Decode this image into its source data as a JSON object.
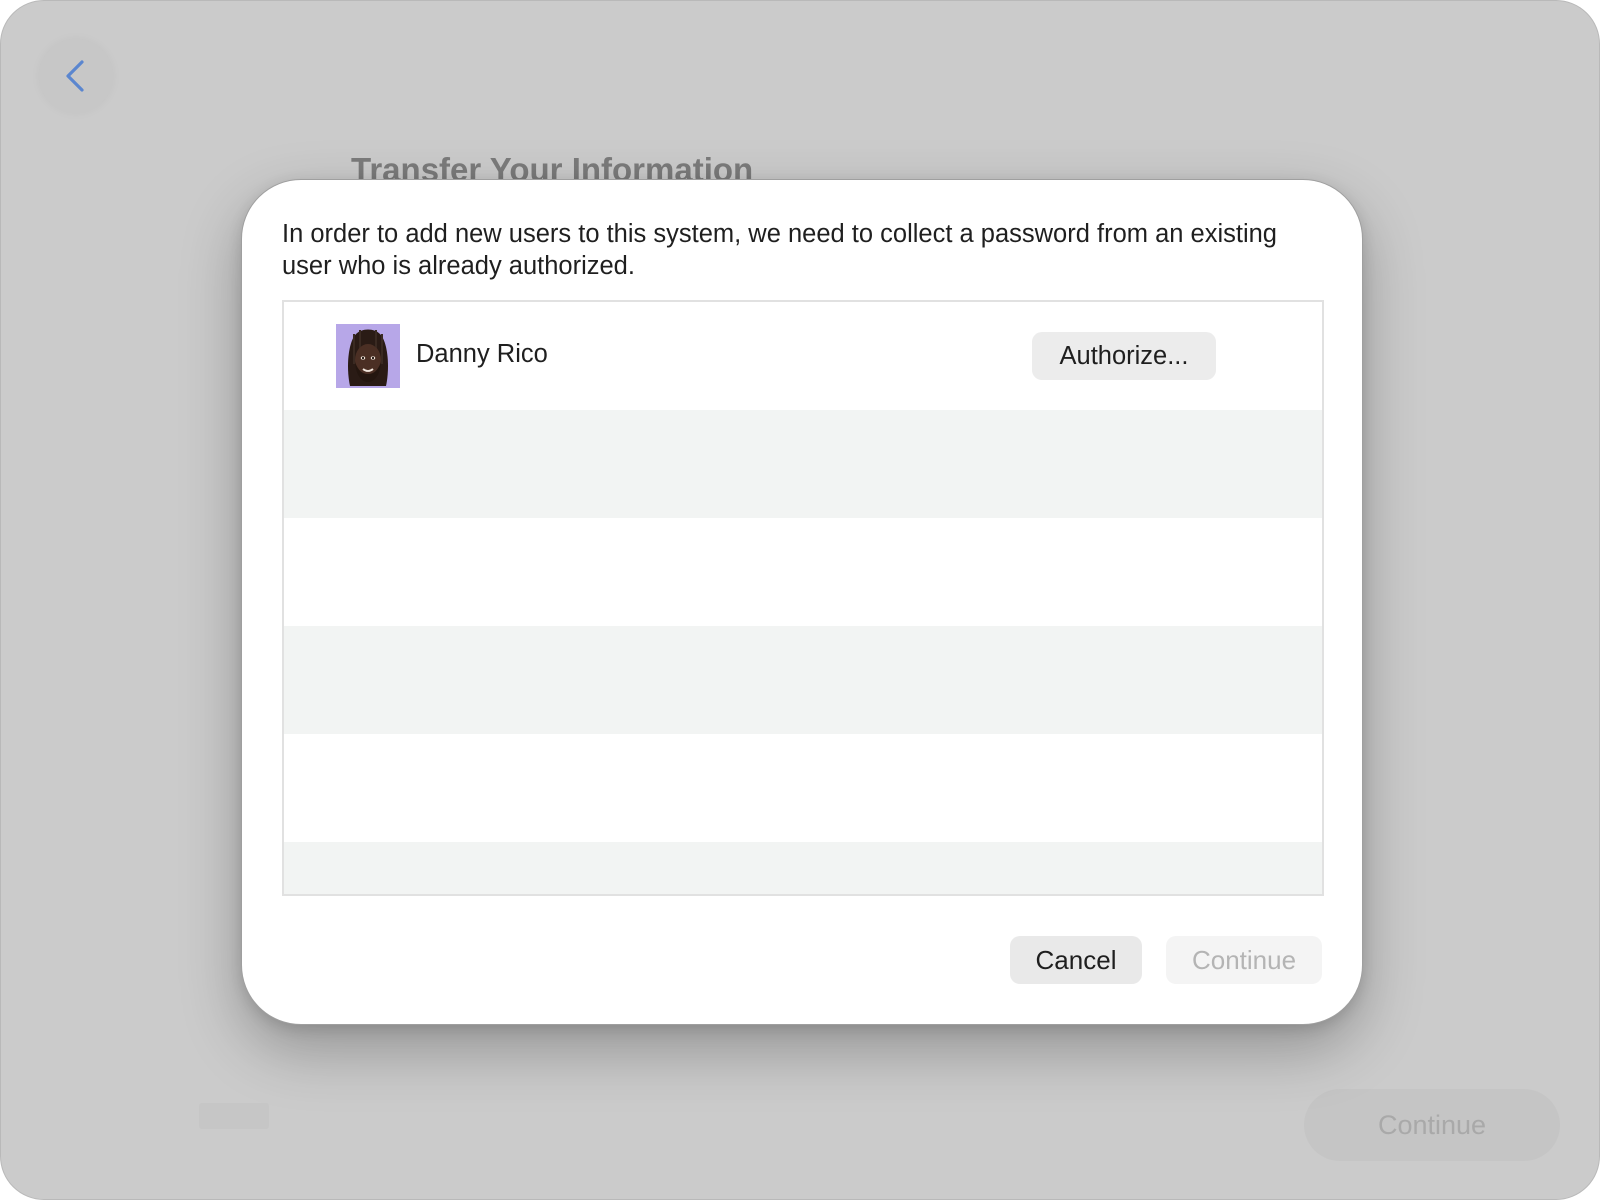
{
  "background": {
    "page_title": "Transfer Your Information",
    "back_icon": "chevron-left-icon",
    "continue_label": "Continue"
  },
  "dialog": {
    "message": "In order to add new users to this system, we need to collect a password from an existing user who is already authorized.",
    "users": [
      {
        "name": "Danny Rico",
        "avatar_icon": "memoji-avatar",
        "avatar_bg_color": "#b7a7e8",
        "action_label": "Authorize..."
      }
    ],
    "cancel_label": "Cancel",
    "continue_label": "Continue",
    "continue_enabled": false
  },
  "colors": {
    "accent": "#4a7fd6",
    "window_bg": "#cbcbcb",
    "dialog_bg": "#ffffff",
    "row_alt": "#f2f4f3"
  }
}
